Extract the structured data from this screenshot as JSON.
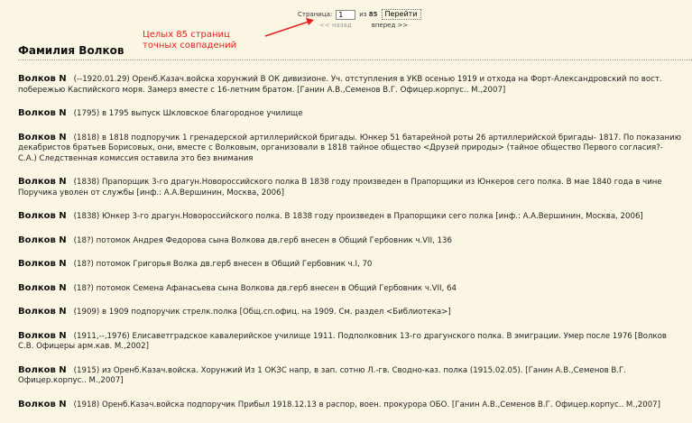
{
  "pager": {
    "page_label": "Страница:",
    "page_value": "1",
    "of_label": "из",
    "total_pages": "85",
    "go_label": "Перейти",
    "prev_label": "<< назад",
    "next_label": "вперед >>"
  },
  "annotation": {
    "text": "Целых 85 страниц точных совпадений",
    "color": "#e2221f"
  },
  "page": {
    "title": "Фамилия Волков"
  },
  "entries": [
    {
      "name": "Волков N",
      "text": "(--1920.01.29) Оренб.Казач.войска хорунжий В ОК дивизионе. Уч. отступления в УКВ осенью 1919 и отхода на Форт-Александровский по вост. побережью Каспийского моря. Замерз вместе с 16-летним братом. [Ганин А.В.,Семенов В.Г. Офицер.корпус.. М.,2007]"
    },
    {
      "name": "Волков N",
      "text": "(1795) в 1795 выпуск Шкловское благородное училище"
    },
    {
      "name": "Волков N",
      "text": "(1818) в 1818 подпоручик 1 гренадерской артиллерийской бригады. Юнкер 51 батарейной роты 26 артиллерийской бригады- 1817. По показанию декабристов братьев Борисовых, они, вместе с Волковым, организовали в 1818 тайное общество <Друзей природы> (тайное общество Первого согласия?- С.А.) Следственная комиссия оставила это без внимания"
    },
    {
      "name": "Волков N",
      "text": "(1838) Прапорщик 3-го драгун.Новороссийского полка В 1838 году произведен в Прапорщики из Юнкеров сего полка. В мае 1840 года в чине Поручика уволен от службы [инф.: А.А.Вершинин, Москва, 2006]"
    },
    {
      "name": "Волков N",
      "text": "(1838) Юнкер 3-го драгун.Новороссийского полка. В 1838 году произведен в Прапорщики сего полка [инф.: А.А.Вершинин, Москва, 2006]"
    },
    {
      "name": "Волков N",
      "text": "(18?) потомок Андрея Федорова сына Волкова дв.герб внесен в Общий Гербовник ч.VII, 136"
    },
    {
      "name": "Волков N",
      "text": "(18?) потомок Григорья Волка дв.герб внесен в Общий Гербовник ч.I, 70"
    },
    {
      "name": "Волков N",
      "text": "(18?) потомок Семена Афанасьева сына Волкова дв.герб внесен в Общий Гербовник ч.VII, 64"
    },
    {
      "name": "Волков N",
      "text": "(1909) в 1909 подпоручик стрелк.полка [Общ.сп.офиц. на 1909. См. раздел <Библиотека>]"
    },
    {
      "name": "Волков N",
      "text": "(1911,--,1976) Елисаветградское кавалерийское училище 1911. Подполковник 13-го драгунского полка. В эмиграции. Умер после 1976 [Волков С.В. Офицеры арм.кав. М.,2002]"
    },
    {
      "name": "Волков N",
      "text": "(1915) из Оренб.Казач.войска. Хорунжий Из 1 ОКЗС напр, в зап. сотню Л.-гв. Сводно-каз. полка (1915.02.05). [Ганин А.В.,Семенов В.Г. Офицер.корпус.. М.,2007]"
    },
    {
      "name": "Волков N",
      "text": "(1918) Оренб.Казач.войска подпоручик Прибыл 1918.12.13 в распор, воен. прокурора ОБО. [Ганин А.В.,Семенов В.Г. Офицер.корпус.. М.,2007]"
    }
  ]
}
